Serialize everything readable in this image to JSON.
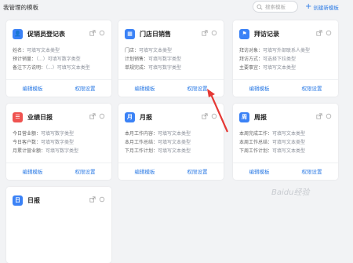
{
  "header": {
    "title": "我管理的模板",
    "search_placeholder": "搜索模板",
    "create_label": "创建新模板"
  },
  "cards": [
    {
      "name": "促销员登记表",
      "color": "#3b82f6",
      "icon": "user-card-icon",
      "icon_char": "👤",
      "fields": [
        {
          "label": "姓名：",
          "value": "可填写文本类型"
        },
        {
          "label": "预计销量：",
          "value": "（...）可填写数字类型"
        },
        {
          "label": "备注下方说明：",
          "value": "（...）可填写文本类型"
        }
      ],
      "edit": "编辑模板",
      "perm": "权限设置"
    },
    {
      "name": "门店日销售",
      "color": "#3b82f6",
      "icon": "store-icon",
      "icon_char": "▦",
      "fields": [
        {
          "label": "门店：",
          "value": "可填写文本类型"
        },
        {
          "label": "计划销售：",
          "value": "可填写数字类型"
        },
        {
          "label": "单规完成：",
          "value": "可填写数字类型"
        }
      ],
      "edit": "编辑模板",
      "perm": "权限设置"
    },
    {
      "name": "拜访记录",
      "color": "#3b82f6",
      "icon": "visit-icon",
      "icon_char": "⚑",
      "fields": [
        {
          "label": "拜访对象：",
          "value": "可填写外部联系人类型"
        },
        {
          "label": "拜访方式：",
          "value": "可选择下拉类型"
        },
        {
          "label": "主要事宜：",
          "value": "可填写文本类型"
        }
      ],
      "edit": "编辑模板",
      "perm": "权限设置"
    },
    {
      "name": "业绩日报",
      "color": "#ef5350",
      "icon": "report-icon",
      "icon_char": "☰",
      "fields": [
        {
          "label": "今日营业额：",
          "value": "可填写数字类型"
        },
        {
          "label": "今日客户数：",
          "value": "可填写数字类型"
        },
        {
          "label": "月累计营业额：",
          "value": "可填写数字类型"
        }
      ],
      "edit": "编辑模板",
      "perm": "权限设置"
    },
    {
      "name": "月报",
      "color": "#3b82f6",
      "icon": "month-icon",
      "icon_char": "月",
      "fields": [
        {
          "label": "本月工作内容：",
          "value": "可填写文本类型"
        },
        {
          "label": "本月工作总结：",
          "value": "可填写文本类型"
        },
        {
          "label": "下月工作计划：",
          "value": "可填写文本类型"
        }
      ],
      "edit": "编辑模板",
      "perm": "权限设置"
    },
    {
      "name": "周报",
      "color": "#3b82f6",
      "icon": "week-icon",
      "icon_char": "周",
      "fields": [
        {
          "label": "本周完成工作：",
          "value": "可填写文本类型"
        },
        {
          "label": "本周工作总结：",
          "value": "可填写文本类型"
        },
        {
          "label": "下周工作计划：",
          "value": "可填写文本类型"
        }
      ],
      "edit": "编辑模板",
      "perm": "权限设置"
    },
    {
      "name": "日报",
      "color": "#3b82f6",
      "icon": "day-icon",
      "icon_char": "日"
    }
  ],
  "watermark": "Baidu经验"
}
